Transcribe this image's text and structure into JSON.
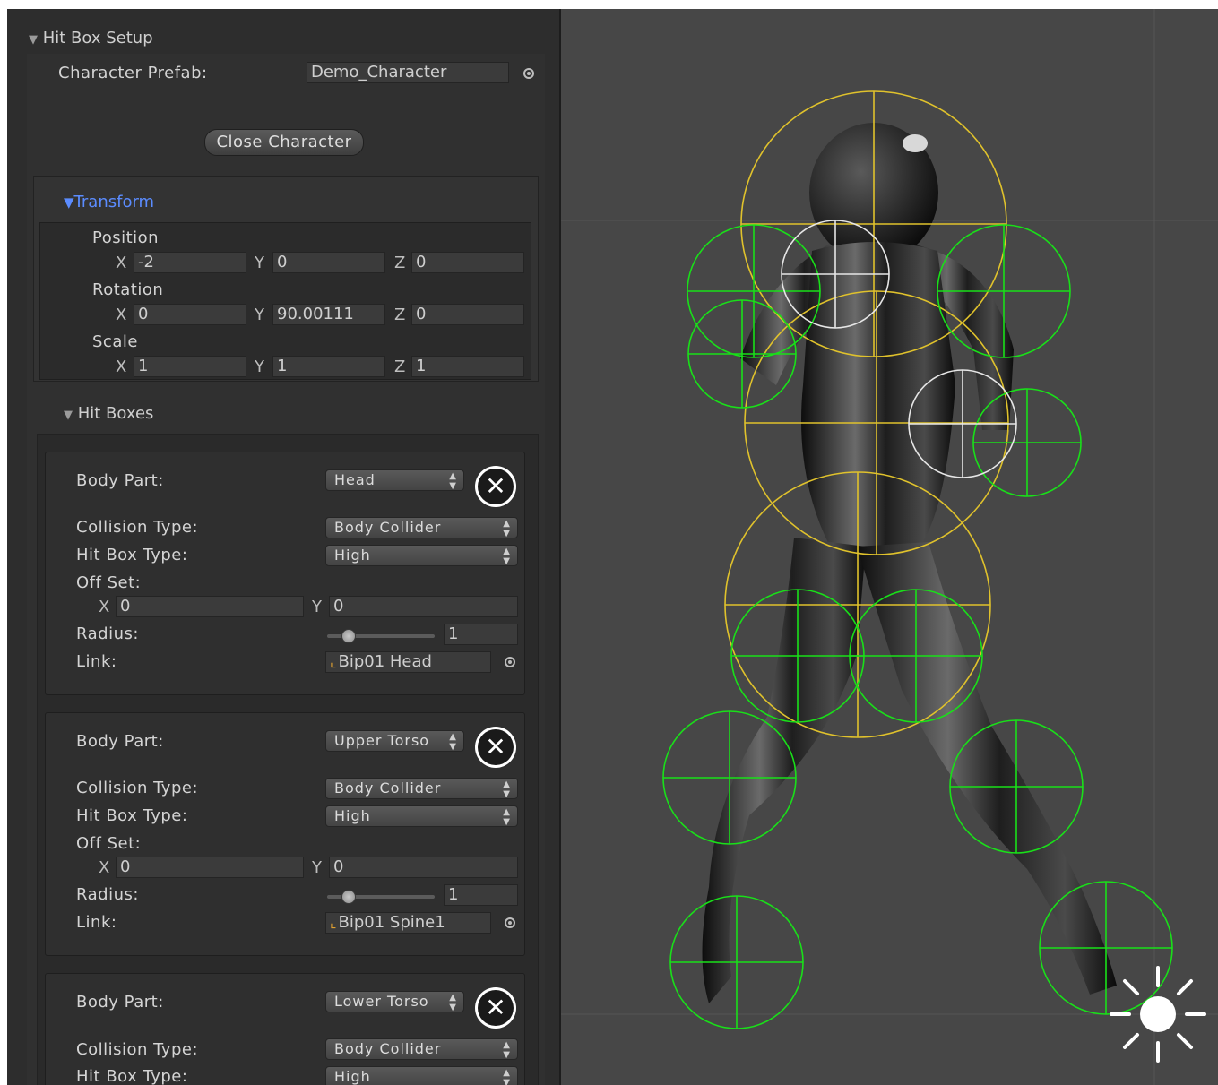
{
  "panel": {
    "title": "Hit Box Setup",
    "character_prefab_label": "Character Prefab:",
    "character_prefab_value": "Demo_Character",
    "close_button": "Close Character",
    "transform": {
      "title": "Transform",
      "position_label": "Position",
      "position": {
        "x": "-2",
        "y": "0",
        "z": "0"
      },
      "rotation_label": "Rotation",
      "rotation": {
        "x": "0",
        "y": "90.00111",
        "z": "0"
      },
      "scale_label": "Scale",
      "scale": {
        "x": "1",
        "y": "1",
        "z": "1"
      },
      "axis_x": "X",
      "axis_y": "Y",
      "axis_z": "Z"
    },
    "hit_boxes_title": "Hit Boxes",
    "labels": {
      "body_part": "Body Part:",
      "collision_type": "Collision Type:",
      "hit_box_type": "Hit Box Type:",
      "off_set": "Off Set:",
      "radius": "Radius:",
      "link": "Link:"
    },
    "hit_boxes": [
      {
        "body_part": "Head",
        "collision_type": "Body Collider",
        "hit_box_type": "High",
        "offset_x": "0",
        "offset_y": "0",
        "radius": "1",
        "link": "Bip01 Head"
      },
      {
        "body_part": "Upper Torso",
        "collision_type": "Body Collider",
        "hit_box_type": "High",
        "offset_x": "0",
        "offset_y": "0",
        "radius": "1",
        "link": "Bip01 Spine1"
      },
      {
        "body_part": "Lower Torso",
        "collision_type": "Body Collider",
        "hit_box_type": "High"
      }
    ]
  },
  "icons": {
    "remove": "close-circle-icon",
    "object_picker": "target-icon",
    "link": "transform-axes-icon",
    "light": "sun-icon"
  },
  "colors": {
    "panel_bg": "#2d2d2d",
    "scene_bg": "#474747",
    "accent_blue": "#5b8cff",
    "gizmo_yellow": "#e0c22c",
    "gizmo_green": "#19e019",
    "gizmo_white": "#e6e6e6"
  }
}
